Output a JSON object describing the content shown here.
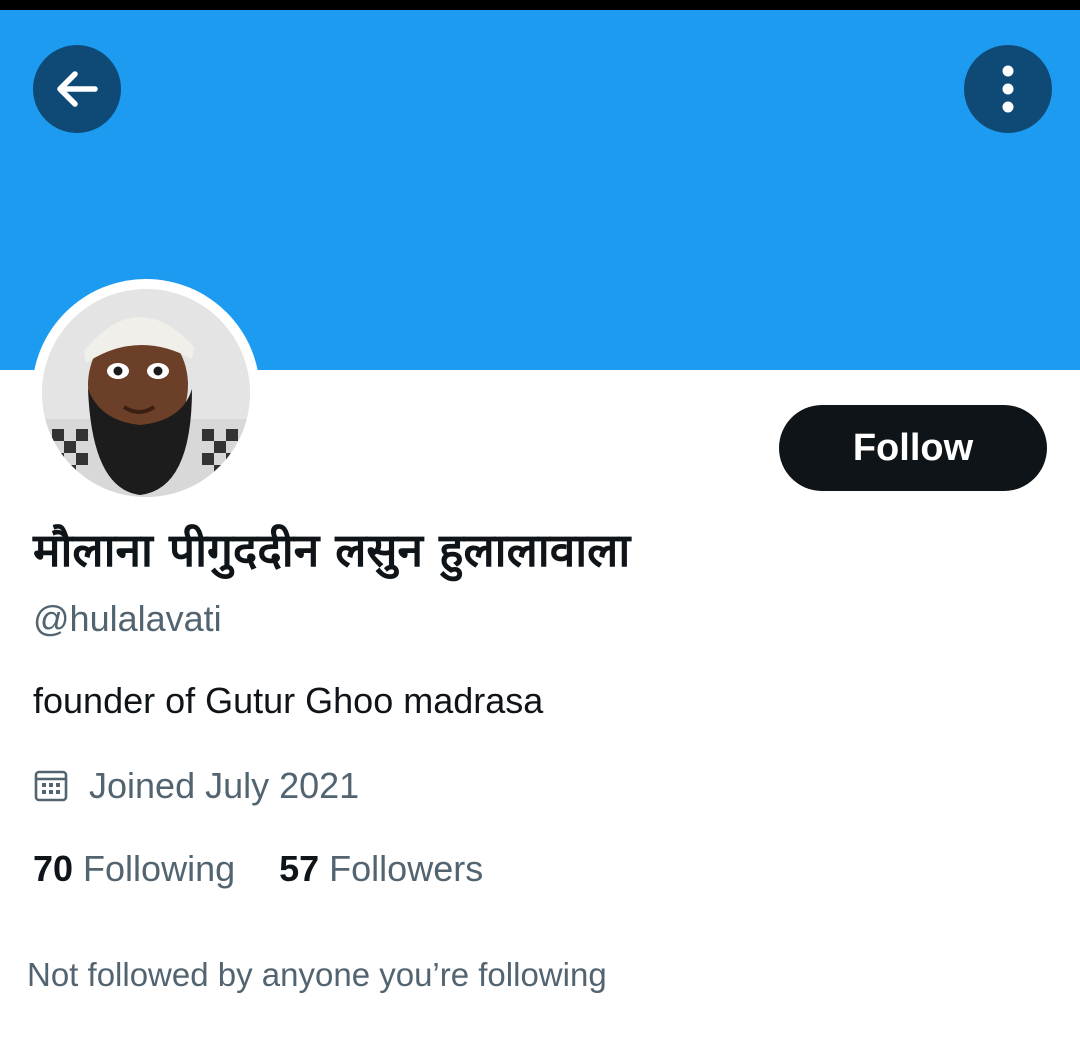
{
  "header": {
    "back_icon": "arrow-left-icon",
    "more_icon": "more-vertical-icon",
    "banner_color": "#1d9bf0",
    "button_color": "#0f4a77"
  },
  "profile": {
    "avatar_icon": "user-avatar-photo",
    "display_name": "मौलाना पीगुददीन लसुन हुलालावाला",
    "handle": "@hulalavati",
    "bio": "founder of Gutur Ghoo madrasa",
    "joined_icon": "calendar-icon",
    "joined": "Joined July 2021",
    "follow_label": "Follow",
    "following_count": "70",
    "following_label": "Following",
    "followers_count": "57",
    "followers_label": "Followers",
    "mutuals_note": "Not followed by anyone you’re following"
  },
  "colors": {
    "primary_text": "#0f1419",
    "secondary_text": "#536471",
    "follow_button": "#0f1419"
  }
}
